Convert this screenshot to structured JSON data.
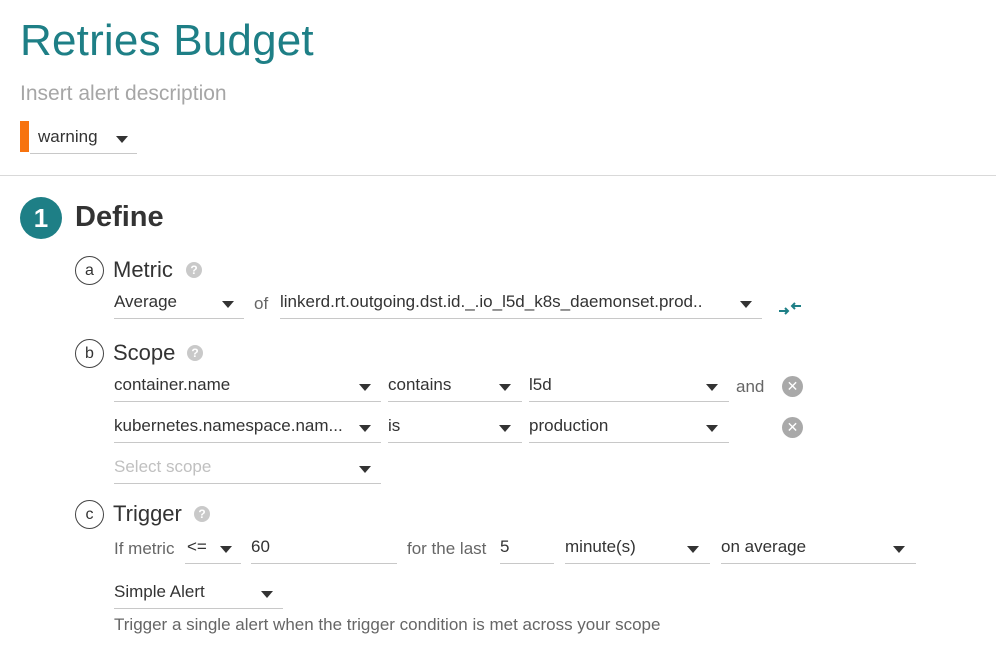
{
  "header": {
    "title": "Retries Budget",
    "description_placeholder": "Insert alert description",
    "severity": "warning",
    "severity_color": "#f7730f"
  },
  "step": {
    "number": "1",
    "label": "Define"
  },
  "metric": {
    "letter": "a",
    "label": "Metric",
    "aggregation": "Average",
    "of_label": "of",
    "metric_name": "linkerd.rt.outgoing.dst.id._.io_l5d_k8s_daemonset.prod..",
    "swap_icon": "swap-arrows-icon"
  },
  "scope": {
    "letter": "b",
    "label": "Scope",
    "rows": [
      {
        "key": "container.name",
        "operator": "contains",
        "value": "l5d",
        "joiner": "and"
      },
      {
        "key": "kubernetes.namespace.nam...",
        "operator": "is",
        "value": "production",
        "joiner": ""
      }
    ],
    "select_placeholder": "Select scope"
  },
  "trigger": {
    "letter": "c",
    "label": "Trigger",
    "if_metric_label": "If metric",
    "comparator": "<=",
    "threshold": "60",
    "for_last_label": "for the last",
    "duration": "5",
    "unit": "minute(s)",
    "aggregation": "on average",
    "alert_type": "Simple Alert",
    "alert_type_hint": "Trigger a single alert when the trigger condition is met across your scope"
  },
  "colors": {
    "accent": "#1e7f86",
    "severity_warning": "#f7730f"
  }
}
